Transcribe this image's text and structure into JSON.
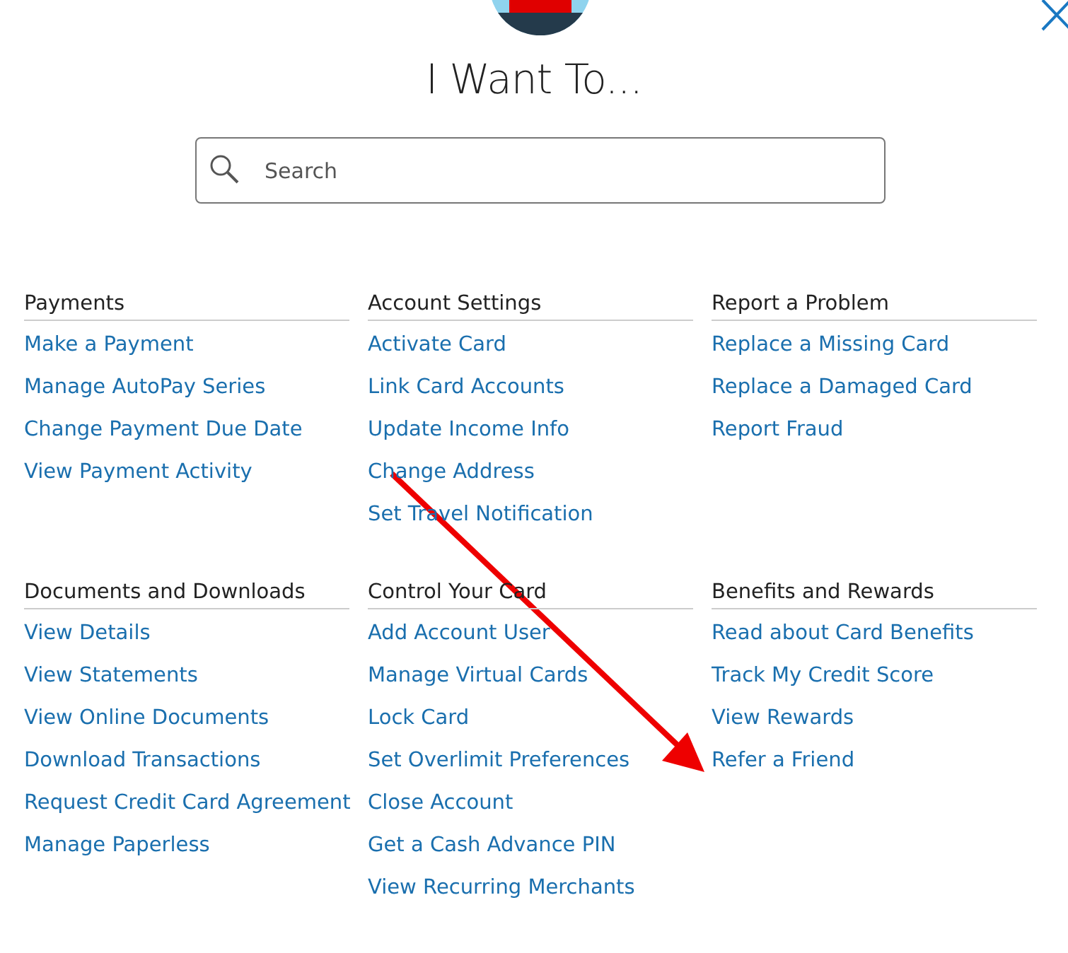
{
  "title": "I Want To...",
  "search": {
    "placeholder": "Search"
  },
  "sections": [
    {
      "heading": "Payments",
      "links": [
        "Make a Payment",
        "Manage AutoPay Series",
        "Change Payment Due Date",
        "View Payment Activity"
      ]
    },
    {
      "heading": "Account Settings",
      "links": [
        "Activate Card",
        "Link Card Accounts",
        "Update Income Info",
        "Change Address",
        "Set Travel Notification"
      ]
    },
    {
      "heading": "Report a Problem",
      "links": [
        "Replace a Missing Card",
        "Replace a Damaged Card",
        "Report Fraud"
      ]
    },
    {
      "heading": "Documents and Downloads",
      "links": [
        "View Details",
        "View Statements",
        "View Online Documents",
        "Download Transactions",
        "Request Credit Card Agreement",
        "Manage Paperless"
      ]
    },
    {
      "heading": "Control Your Card",
      "links": [
        "Add Account User",
        "Manage Virtual Cards",
        "Lock Card",
        "Set Overlimit Preferences",
        "Close Account",
        "Get a Cash Advance PIN",
        "View Recurring Merchants"
      ]
    },
    {
      "heading": "Benefits and Rewards",
      "links": [
        "Read about Card Benefits",
        "Track My Credit Score",
        "View Rewards",
        "Refer a Friend"
      ]
    }
  ]
}
